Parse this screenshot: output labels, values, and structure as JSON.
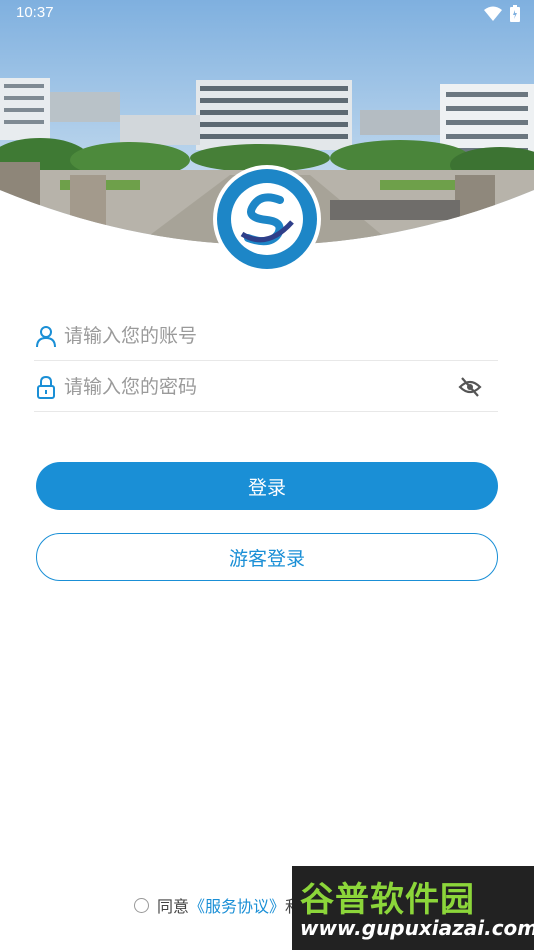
{
  "status_bar": {
    "time": "10:37"
  },
  "logo": {
    "name": "school-logo"
  },
  "form": {
    "account_placeholder": "请输入您的账号",
    "password_placeholder": "请输入您的密码"
  },
  "buttons": {
    "login": "登录",
    "guest_login": "游客登录"
  },
  "agreement": {
    "agree_text": "同意",
    "service_link": "《服务协议》",
    "and_text": "和"
  },
  "watermark": {
    "title": "谷普软件园",
    "url": "www.gupuxiazai.com"
  },
  "colors": {
    "primary": "#1a8fd6",
    "watermark_green": "#8cd63a"
  }
}
